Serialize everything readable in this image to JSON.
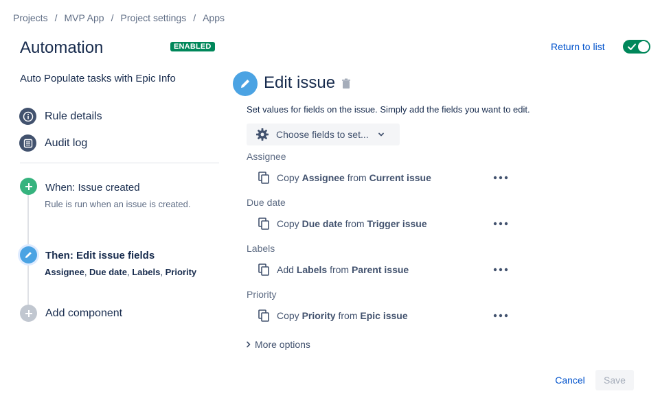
{
  "breadcrumb": {
    "items": [
      "Projects",
      "MVP App",
      "Project settings",
      "Apps"
    ],
    "separator": "/"
  },
  "header": {
    "title": "Automation",
    "status_badge": "ENABLED",
    "return_link": "Return to list",
    "toggle_on": true
  },
  "sidebar": {
    "rule_name": "Auto Populate tasks with Epic Info",
    "items": [
      {
        "label": "Rule details",
        "icon": "info-icon"
      },
      {
        "label": "Audit log",
        "icon": "list-icon"
      }
    ],
    "steps": {
      "trigger": {
        "title": "When: Issue created",
        "subtitle": "Rule is run when an issue is created.",
        "icon": "plus-icon",
        "color": "#36b37e"
      },
      "action": {
        "title": "Then: Edit issue fields",
        "fields": [
          "Assignee",
          "Due date",
          "Labels",
          "Priority"
        ],
        "icon": "pencil-icon",
        "color": "#4ba3e3"
      },
      "add": {
        "label": "Add component",
        "icon": "plus-icon",
        "color": "#c1c7d0"
      }
    }
  },
  "main": {
    "title": "Edit issue",
    "description": "Set values for fields on the issue. Simply add the fields you want to edit.",
    "choose_fields_label": "Choose fields to set...",
    "fields": [
      {
        "label": "Assignee",
        "verb": "Copy",
        "field": "Assignee",
        "from": "from",
        "source": "Current issue"
      },
      {
        "label": "Due date",
        "verb": "Copy",
        "field": "Due date",
        "from": "from",
        "source": "Trigger issue"
      },
      {
        "label": "Labels",
        "verb": "Add",
        "field": "Labels",
        "from": "from",
        "source": "Parent issue"
      },
      {
        "label": "Priority",
        "verb": "Copy",
        "field": "Priority",
        "from": "from",
        "source": "Epic issue"
      }
    ],
    "more_options": "More options",
    "cancel_label": "Cancel",
    "save_label": "Save"
  },
  "colors": {
    "accent_green": "#00875a",
    "link_blue": "#0052cc",
    "edit_blue": "#4ba3e3",
    "trigger_green": "#36b37e"
  }
}
